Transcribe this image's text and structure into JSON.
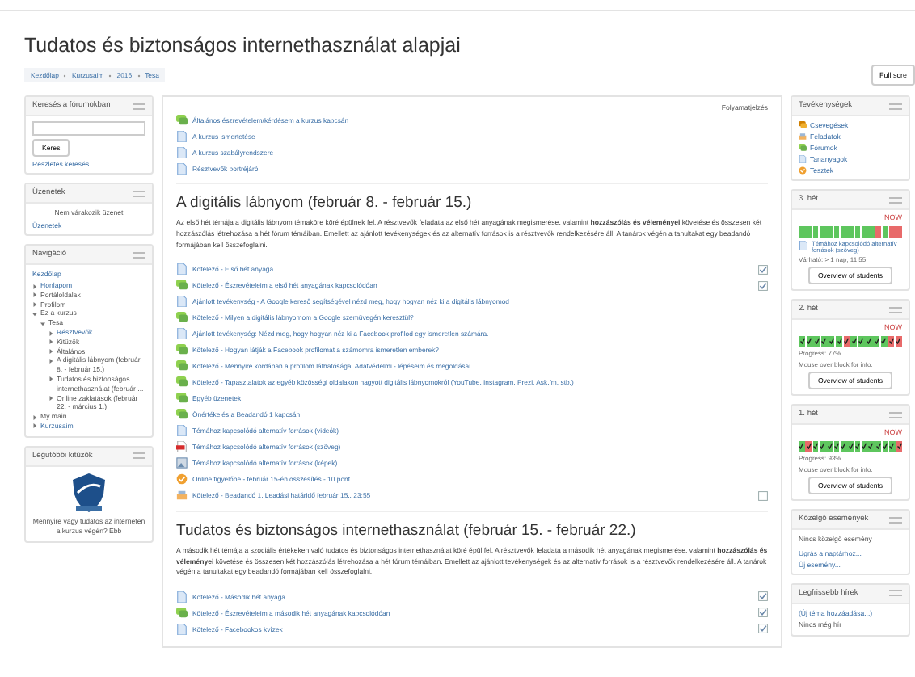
{
  "title": "Tudatos és biztonságos internethasználat alapjai",
  "breadcrumb": [
    "Kezdőlap",
    "Kurzusaim",
    "2016",
    "Tesa"
  ],
  "full_screen_button": "Full scre",
  "search_block": {
    "title": "Keresés a fórumokban",
    "button": "Keres",
    "advanced_link": "Részletes keresés"
  },
  "messages_block": {
    "title": "Üzenetek",
    "text": "Nem várakozik üzenet",
    "link": "Üzenetek"
  },
  "navigation_block": {
    "title": "Navigáció",
    "home": "Kezdőlap",
    "items": [
      {
        "label": "Honlapom",
        "link": true,
        "expanded": false
      },
      {
        "label": "Portáloldalak",
        "link": false,
        "expanded": false
      },
      {
        "label": "Profilom",
        "link": false,
        "expanded": false
      },
      {
        "label": "Ez a kurzus",
        "link": false,
        "expanded": true,
        "children": [
          {
            "label": "Tesa",
            "link": false,
            "expanded": true,
            "children": [
              {
                "label": "Résztvevők",
                "link": true,
                "expanded": false
              },
              {
                "label": "Kitűzők",
                "link": false,
                "expanded": false
              },
              {
                "label": "Általános",
                "link": false,
                "expanded": false
              },
              {
                "label": "A digitális lábnyom (február 8. - február 15.)",
                "link": false,
                "expanded": false
              },
              {
                "label": "Tudatos és biztonságos internethasználat (február ...",
                "link": false,
                "expanded": false
              },
              {
                "label": "Online zaklatások (február 22. - március 1.)",
                "link": false,
                "expanded": false
              }
            ]
          }
        ]
      },
      {
        "label": "My main",
        "link": false,
        "expanded": false
      },
      {
        "label": "Kurzusaim",
        "link": true,
        "expanded": false
      }
    ]
  },
  "badges_block": {
    "title": "Legutóbbi kitűzők",
    "badge_caption": "Mennyire vagy tudatos az interneten a kurzus végén? Ebb"
  },
  "progress_label": "Folyamatjelzés",
  "general_items": [
    {
      "kind": "forum",
      "label": "Általános észrevételem/kérdésem a kurzus kapcsán"
    },
    {
      "kind": "page",
      "label": "A kurzus ismertetése"
    },
    {
      "kind": "page",
      "label": "A kurzus szabályrendszere"
    },
    {
      "kind": "page",
      "label": "Résztvevők portréjáról"
    }
  ],
  "sections": [
    {
      "title": "A digitális lábnyom (február 8. - február 15.)",
      "summary": "Az első hét témája a digitális lábnyom témaköre köré épülnek fel. A résztvevők feladata az első hét anyagának megismerése, valamint **hozzászólás és véleményei** követése és összesen két hozzászólás létrehozása a hét fórum témáiban. Emellett az ajánlott tevékenységek és az alternatív források is a résztvevők rendelkezésére áll. A tanárok végén a tanultakat egy beadandó formájában kell összefoglalni.",
      "items": [
        {
          "kind": "page",
          "label": "Kötelező - Első hét anyaga",
          "checked": true
        },
        {
          "kind": "forum",
          "label": "Kötelező - Észrevételeim a első hét anyagának kapcsolódóan",
          "checked": true
        },
        {
          "kind": "page",
          "label": "Ajánlott tevékenység - A Google kereső segítségével nézd meg, hogy hogyan néz ki a digitális lábnyomod"
        },
        {
          "kind": "forum",
          "label": "Kötelező - Milyen a digitális lábnyomom a Google szemüvegén keresztül?"
        },
        {
          "kind": "page",
          "label": "Ajánlott tevékenység: Nézd meg, hogy hogyan néz ki a Facebook profilod egy ismeretlen számára."
        },
        {
          "kind": "forum",
          "label": "Kötelező - Hogyan látják a Facebook profilomat a számomra ismeretlen emberek?"
        },
        {
          "kind": "forum",
          "label": "Kötelező - Mennyire kordában a profilom láthatósága. Adatvédelmi - lépéseim és megoldásai"
        },
        {
          "kind": "forum",
          "label": "Kötelező - Tapasztalatok az egyéb közösségi oldalakon hagyott digitális lábnyomokról (YouTube, Instagram, Prezi, Ask.fm, stb.)"
        },
        {
          "kind": "forum",
          "label": "Egyéb üzenetek"
        },
        {
          "kind": "forum",
          "label": "Önértékelés a Beadandó 1 kapcsán"
        },
        {
          "kind": "page",
          "label": "Témához kapcsolódó alternatív források (videók)"
        },
        {
          "kind": "pdf",
          "label": "Témához kapcsolódó alternatív források (szöveg)"
        },
        {
          "kind": "image",
          "label": "Témához kapcsolódó alternatív források (képek)"
        },
        {
          "kind": "quiz",
          "label": "Online figyelőbe - február 15-én összesítés - 10 pont"
        },
        {
          "kind": "assign",
          "label": "Kötelező - Beadandó 1. Leadási határidő február 15., 23:55",
          "checked": false
        }
      ]
    },
    {
      "title": "Tudatos és biztonságos internethasználat (február 15. - február 22.)",
      "summary": "A második hét témája a szociális értékeken való tudatos és biztonságos internethasználat köré épül fel. A résztvevők feladata a második hét anyagának megismerése, valamint **hozzászólás és véleményei** követése és összesen két hozzászólás létrehozása a hét fórum témáiban. Emellett az ajánlott tevékenységek és az alternatív források is a résztvevők rendelkezésére áll. A tanárok végén a tanultakat egy beadandó formájában kell összefoglalni.",
      "items": [
        {
          "kind": "page",
          "label": "Kötelező - Második hét anyaga",
          "checked": true
        },
        {
          "kind": "forum",
          "label": "Kötelező - Észrevételeim a második hét anyagának kapcsolódóan",
          "checked": true
        },
        {
          "kind": "page",
          "label": "Kötelező - Facebookos kvízek",
          "checked": true
        }
      ]
    }
  ],
  "activities_block": {
    "title": "Tevékenységek",
    "items": [
      {
        "kind": "chat",
        "label": "Csevegések"
      },
      {
        "kind": "assign",
        "label": "Feladatok"
      },
      {
        "kind": "forum",
        "label": "Fórumok"
      },
      {
        "kind": "page",
        "label": "Tananyagok"
      },
      {
        "kind": "quiz",
        "label": "Tesztek"
      }
    ]
  },
  "progress_blocks": [
    {
      "title": "3. hét",
      "now": "NOW",
      "ticks": false,
      "cells": [
        true,
        true,
        true,
        true,
        true,
        true,
        true,
        true,
        true,
        true,
        true,
        false,
        true,
        false,
        false
      ],
      "info_item": "Témához kapcsolódó alternatív források (szöveg)",
      "info_status": "Várható: > 1 nap, 11:55",
      "button": "Overview of students"
    },
    {
      "title": "2. hét",
      "now": "NOW",
      "ticks": true,
      "cells": [
        true,
        true,
        true,
        true,
        true,
        true,
        false,
        true,
        true,
        true,
        true,
        true,
        false,
        false
      ],
      "info_lines": [
        "Progress: 77%",
        "Mouse over block for info."
      ],
      "button": "Overview of students"
    },
    {
      "title": "1. hét",
      "now": "NOW",
      "ticks": true,
      "cells": [
        true,
        false,
        true,
        true,
        true,
        true,
        true,
        true,
        true,
        true,
        true,
        true,
        true,
        true,
        false
      ],
      "info_lines": [
        "Progress: 93%",
        "Mouse over block for info."
      ],
      "button": "Overview of students"
    }
  ],
  "events_block": {
    "title": "Közelgő események",
    "text": "Nincs közelgő esemény",
    "links": [
      "Ugrás a naptárhoz...",
      "Új esemény..."
    ]
  },
  "news_block": {
    "title": "Legfrissebb hírek",
    "link": "(Új téma hozzáadása...)",
    "text": "Nincs még hír"
  }
}
